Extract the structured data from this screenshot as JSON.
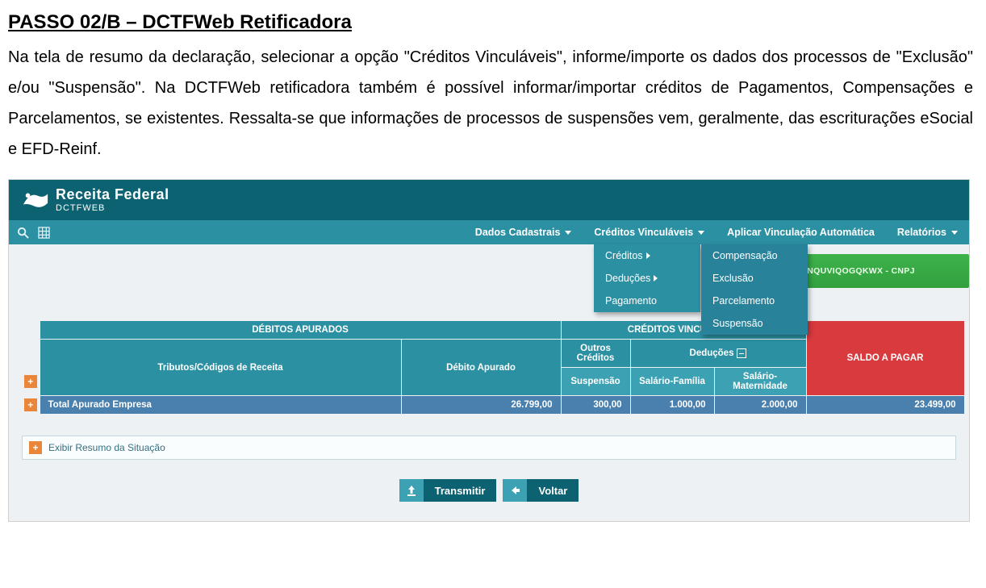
{
  "doc": {
    "title": "PASSO 02/B – DCTFWeb Retificadora",
    "body": "Na tela de resumo da declaração, selecionar a opção \"Créditos Vinculáveis\", informe/importe os dados dos processos de \"Exclusão\" e/ou \"Suspensão\". Na DCTFWeb retificadora também é possível informar/importar créditos de Pagamentos, Compensações e Parcelamentos, se existentes. Ressalta-se que informações de processos de suspensões vem, geralmente, das escriturações eSocial e EFD-Reinf."
  },
  "brand": {
    "main": "Receita Federal",
    "sub": "DCTFWEB"
  },
  "menu": {
    "items": [
      "Dados Cadastrais",
      "Créditos Vinculáveis",
      "Aplicar Vinculação Automática",
      "Relatórios"
    ],
    "creditos_sub": [
      "Créditos",
      "Deduções",
      "Pagamento"
    ],
    "creditos_sub2": [
      "Compensação",
      "Exclusão",
      "Parcelamento",
      "Suspensão"
    ]
  },
  "badge": "NQUVIQOGQKWX - CNPJ",
  "table": {
    "groups": {
      "debitos": "DÉBITOS APURADOS",
      "creditos": "CRÉDITOS VINCULADOS",
      "saldo": "SALDO A PAGAR"
    },
    "headers": {
      "tributos": "Tributos/Códigos de Receita",
      "debito_apurado": "Débito Apurado",
      "outros_creditos": "Outros Créditos",
      "deducoes": "Deduções",
      "suspensao": "Suspensão",
      "salario_familia": "Salário-Família",
      "salario_maternidade": "Salário-Maternidade"
    },
    "total_row": {
      "label": "Total Apurado Empresa",
      "debito_apurado": "26.799,00",
      "suspensao": "300,00",
      "salario_familia": "1.000,00",
      "salario_maternidade": "2.000,00",
      "saldo": "23.499,00"
    }
  },
  "resumo": {
    "label": "Exibir Resumo da Situação"
  },
  "actions": {
    "transmitir": "Transmitir",
    "voltar": "Voltar"
  }
}
